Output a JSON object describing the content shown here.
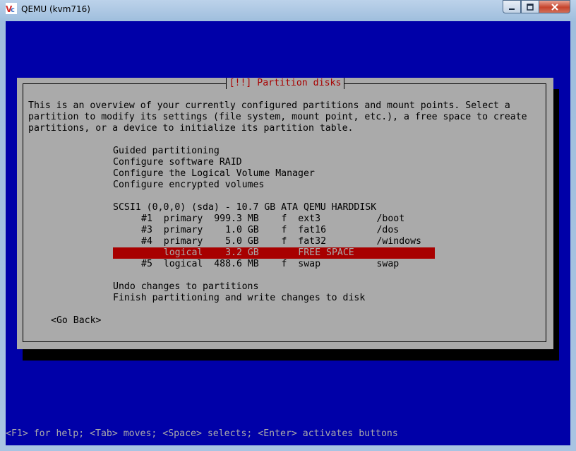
{
  "window": {
    "title": "QEMU (kvm716)",
    "caption_buttons": [
      "minimize",
      "maximize",
      "close"
    ]
  },
  "dialog": {
    "title": "[!!] Partition disks",
    "intro": [
      "This is an overview of your currently configured partitions and mount points. Select a",
      "partition to modify its settings (file system, mount point, etc.), a free space to create",
      "partitions, or a device to initialize its partition table."
    ],
    "menu": [
      "Guided partitioning",
      "Configure software RAID",
      "Configure the Logical Volume Manager",
      "Configure encrypted volumes"
    ],
    "disk": "SCSI1 (0,0,0) (sda) - 10.7 GB ATA QEMU HARDDISK",
    "partitions": [
      "#1  primary  999.3 MB    f  ext3          /boot",
      "#3  primary    1.0 GB    f  fat16         /dos",
      "#4  primary    5.0 GB    f  fat32         /windows",
      "    logical    3.2 GB       FREE SPACE",
      "#5  logical  488.6 MB    f  swap          swap"
    ],
    "selected_partition_index": 3,
    "actions": [
      "Undo changes to partitions",
      "Finish partitioning and write changes to disk"
    ],
    "go_back": "<Go Back>"
  },
  "help_line": "<F1> for help; <Tab> moves; <Space> selects; <Enter> activates buttons",
  "colors": {
    "screen_bg": "#0000a8",
    "dialog_bg": "#aaaaaa",
    "title_fg": "#a80000",
    "highlight_bg": "#a80000"
  }
}
